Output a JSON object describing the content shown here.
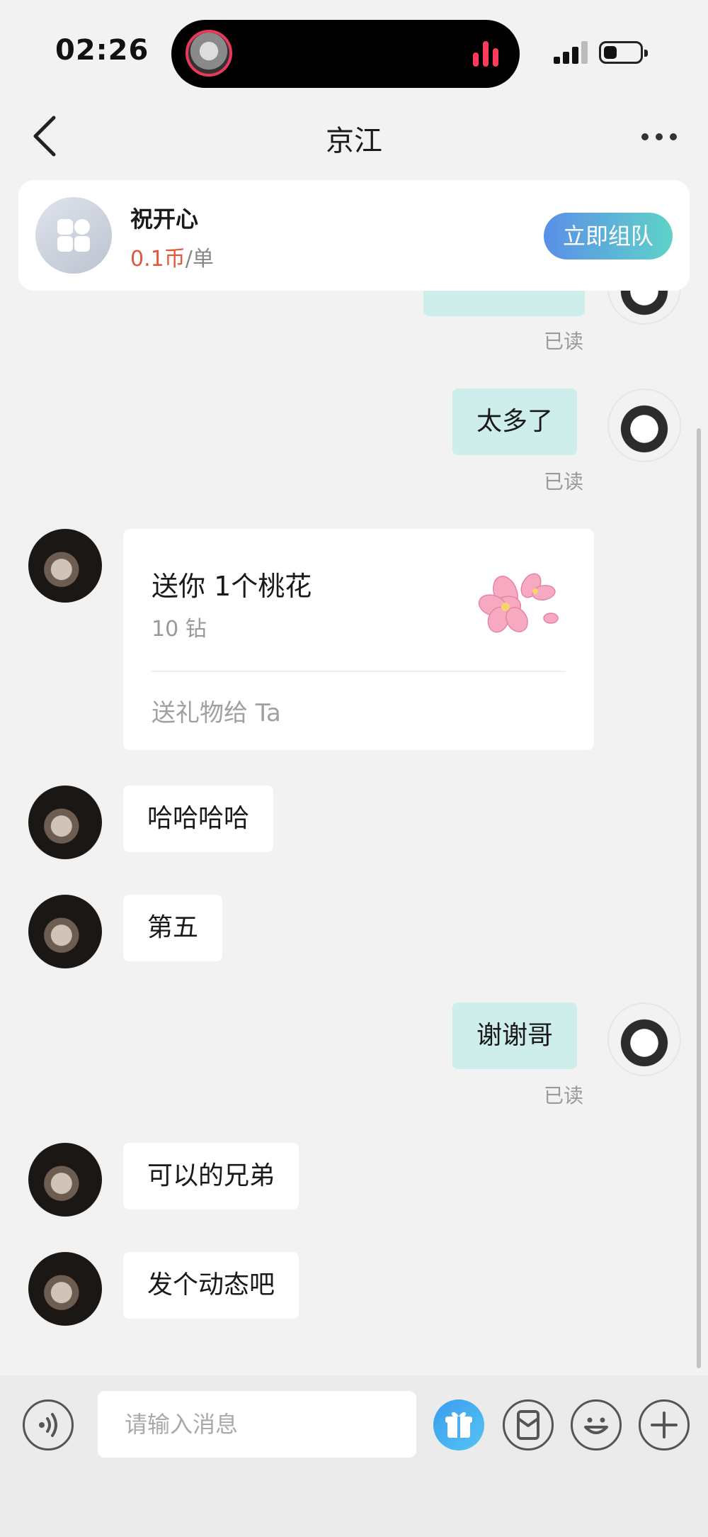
{
  "status_bar": {
    "time": "02:26"
  },
  "header": {
    "title": "京江"
  },
  "service_card": {
    "name": "祝开心",
    "price": "0.1币",
    "unit": "/单",
    "button": "立即组队"
  },
  "messages": {
    "m0_read": "已读",
    "m1_text": "太多了",
    "m1_read": "已读",
    "gift": {
      "title": "送你 1个桃花",
      "price": "10 钻",
      "link": "送礼物给 Ta"
    },
    "m2_text": "哈哈哈哈",
    "m3_text": "第五",
    "m4_text": "谢谢哥",
    "m4_read": "已读",
    "m5_text": "可以的兄弟",
    "m6_text": "发个动态吧"
  },
  "input_bar": {
    "placeholder": "请输入消息"
  },
  "colors": {
    "my_bubble": "#cdeeeb",
    "price": "#e0573c",
    "accent_gradient_start": "#5a8fe8",
    "accent_gradient_end": "#5fd3c8"
  }
}
